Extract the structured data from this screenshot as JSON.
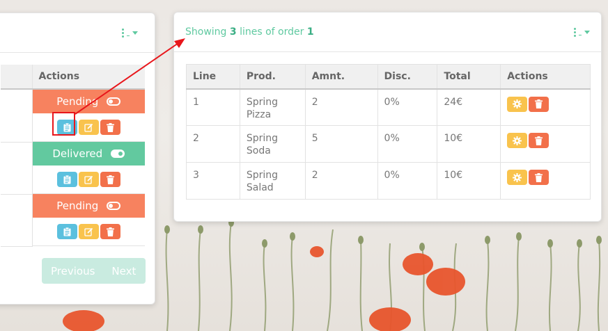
{
  "left_panel": {
    "actions_header": "Actions",
    "rows": [
      {
        "status": "Pending",
        "toggle": "off",
        "status_color": "#f7825f"
      },
      {
        "status": "Delivered",
        "toggle": "on",
        "status_color": "#62c99f"
      },
      {
        "status": "Pending",
        "toggle": "off",
        "status_color": "#f7825f"
      }
    ],
    "pagination": {
      "previous": "Previous",
      "next": "Next"
    }
  },
  "right_panel": {
    "title_prefix": "Showing ",
    "line_count": "3",
    "title_middle": " lines of order ",
    "order_number": "1",
    "columns": [
      "Line",
      "Prod.",
      "Amnt.",
      "Disc.",
      "Total",
      "Actions"
    ],
    "rows": [
      {
        "line": "1",
        "product": "Spring Pizza",
        "amount": "2",
        "discount": "0%",
        "total": "24€"
      },
      {
        "line": "2",
        "product": "Spring Soda",
        "amount": "5",
        "discount": "0%",
        "total": "10€"
      },
      {
        "line": "3",
        "product": "Spring Salad",
        "amount": "2",
        "discount": "0%",
        "total": "10€"
      }
    ]
  },
  "icons": {
    "view": "clipboard-icon",
    "edit": "edit-icon",
    "delete": "trash-icon",
    "settings": "gear-icon",
    "menu": "kebab-menu-icon"
  },
  "colors": {
    "accent": "#5fc9a0",
    "pending": "#f7825f",
    "delivered": "#62c99f",
    "view_button": "#5bc0de",
    "edit_button": "#f9c34d",
    "delete_button": "#f2704a",
    "annotation": "#e8161b"
  }
}
